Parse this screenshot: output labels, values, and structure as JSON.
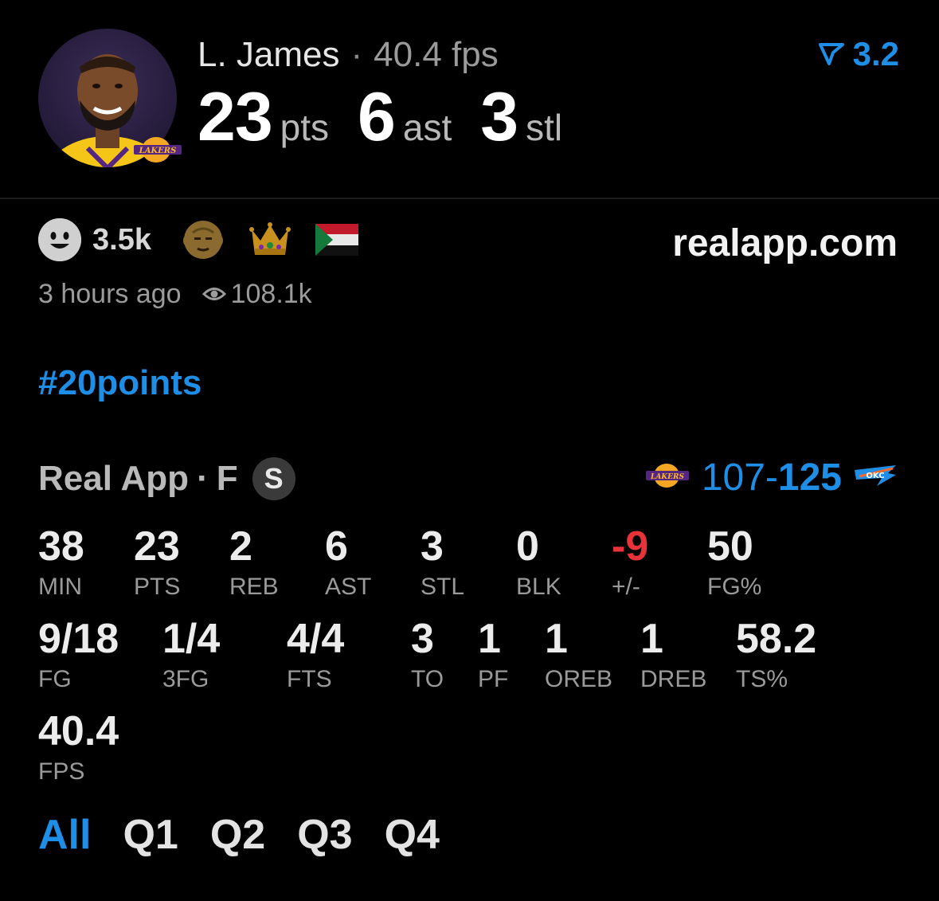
{
  "player": {
    "name": "L. James",
    "fps_line": "40.4 fps",
    "separator": "·",
    "headline": [
      {
        "value": "23",
        "unit": "pts"
      },
      {
        "value": "6",
        "unit": "ast"
      },
      {
        "value": "3",
        "unit": "stl"
      }
    ],
    "rating": "3.2",
    "avatar_icon": "player-avatar",
    "team_icon": "lakers-logo"
  },
  "reactions": {
    "count": "3.5k",
    "items": [
      "smiley-icon",
      "old-man-emoji",
      "crown-emoji",
      "sudan-flag-emoji"
    ]
  },
  "site": "realapp.com",
  "meta": {
    "time": "3 hours ago",
    "views": "108.1k"
  },
  "hashtag": "#20points",
  "game": {
    "source": "Real App",
    "dot": "·",
    "position": "F",
    "badge": "S",
    "score_left": "107-",
    "score_right": "125",
    "home_team_icon": "lakers-logo",
    "away_team_icon": "thunder-logo"
  },
  "stats_row1": [
    {
      "value": "38",
      "label": "MIN"
    },
    {
      "value": "23",
      "label": "PTS"
    },
    {
      "value": "2",
      "label": "REB"
    },
    {
      "value": "6",
      "label": "AST"
    },
    {
      "value": "3",
      "label": "STL"
    },
    {
      "value": "0",
      "label": "BLK"
    },
    {
      "value": "-9",
      "label": "+/-"
    },
    {
      "value": "50",
      "label": "FG%"
    }
  ],
  "stats_row2": [
    {
      "value": "9/18",
      "label": "FG"
    },
    {
      "value": "1/4",
      "label": "3FG"
    },
    {
      "value": "4/4",
      "label": "FTS"
    },
    {
      "value": "3",
      "label": "TO"
    },
    {
      "value": "1",
      "label": "PF"
    },
    {
      "value": "1",
      "label": "OREB"
    },
    {
      "value": "1",
      "label": "DREB"
    },
    {
      "value": "58.2",
      "label": "TS%"
    }
  ],
  "stats_row3": [
    {
      "value": "40.4",
      "label": "FPS"
    }
  ],
  "tabs": [
    "All",
    "Q1",
    "Q2",
    "Q3",
    "Q4"
  ],
  "colors": {
    "accent": "#1e8ee6",
    "negative": "#e8333a",
    "background": "#000000"
  }
}
